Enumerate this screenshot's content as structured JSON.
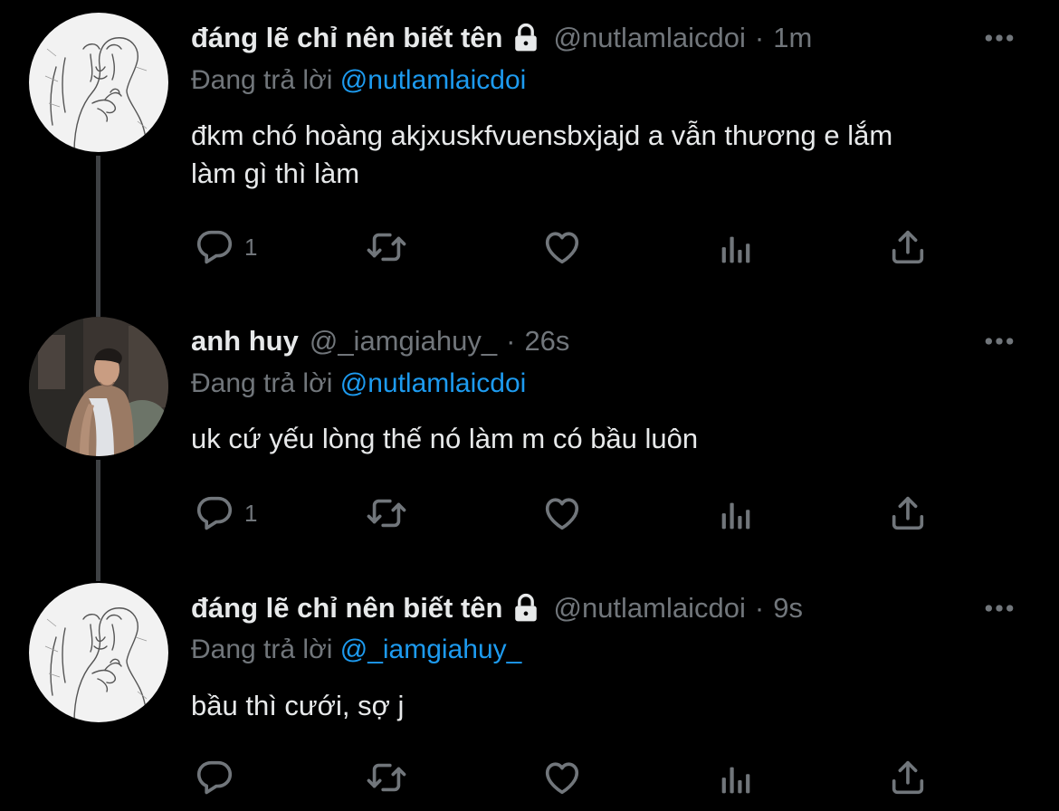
{
  "colors": {
    "background": "#000000",
    "text": "#e7e9ea",
    "secondary": "#71767b",
    "link": "#1d9bf0",
    "thread_line": "#3e4144"
  },
  "tweets": [
    {
      "name": "đáng lẽ chỉ nên biết tên",
      "handle": "@nutlamlaicdoi",
      "separator": "·",
      "time": "1m",
      "protected": true,
      "replying_prefix": "Đang trả lời",
      "replying_to": "@nutlamlaicdoi",
      "text_lines": [
        "đkm chó hoàng akjxuskfvuensbxjajd a vẫn thương e lắm",
        "làm gì thì làm"
      ],
      "reply_count": "1",
      "avatar_icon": "sketch-avatar-icon"
    },
    {
      "name": "anh huy",
      "handle": "@_iamgiahuy_",
      "separator": "·",
      "time": "26s",
      "protected": false,
      "replying_prefix": "Đang trả lời",
      "replying_to": "@nutlamlaicdoi",
      "text_lines": [
        "uk cứ yếu lòng thế nó làm m có bầu luôn"
      ],
      "reply_count": "1",
      "avatar_icon": "photo-avatar-icon"
    },
    {
      "name": "đáng lẽ chỉ nên biết tên",
      "handle": "@nutlamlaicdoi",
      "separator": "·",
      "time": "9s",
      "protected": true,
      "replying_prefix": "Đang trả lời",
      "replying_to": "@_iamgiahuy_",
      "text_lines": [
        "bầu thì cưới, sợ j"
      ],
      "reply_count": "",
      "avatar_icon": "sketch-avatar-icon"
    }
  ]
}
